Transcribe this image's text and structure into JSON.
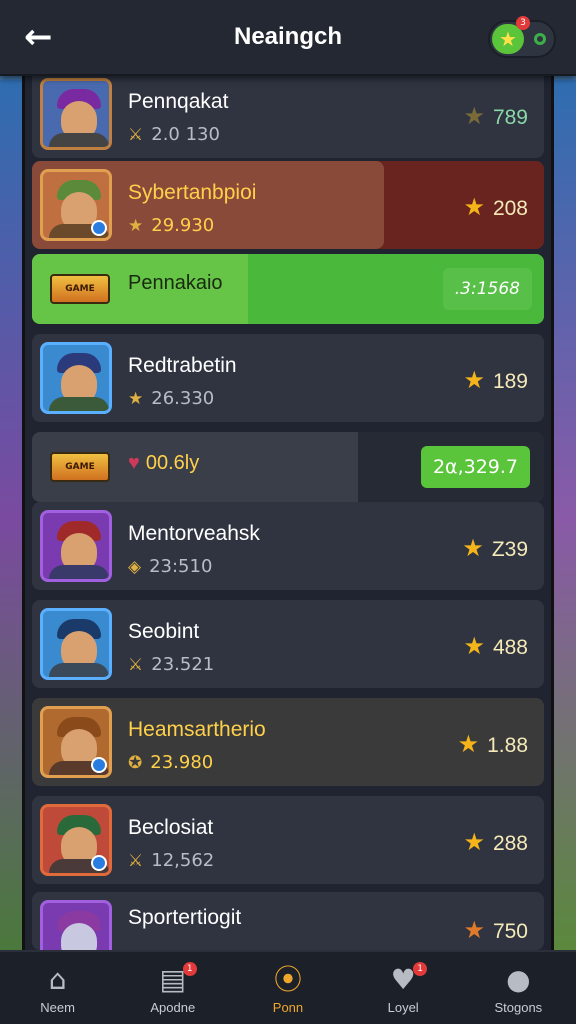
{
  "header": {
    "title": "Neaingch",
    "back_icon": "arrow-left-icon",
    "toggle_badge": "3"
  },
  "rows": [
    {
      "name": "Pennqakat",
      "sub": "2.0 130",
      "score": "789",
      "hat": "#7a2aa0",
      "border": "#c08040"
    },
    {
      "name": "Sybertanbpioi",
      "sub": "29.930",
      "score": "208",
      "hat": "#5a8a3a",
      "border": "#e0a050"
    },
    {
      "name": "Redtrabetin",
      "sub": "26.330",
      "score": "189",
      "hat": "#2a3a7a",
      "border": "#5ab0ff"
    },
    {
      "name": "Mentorveahsk",
      "sub": "23:510",
      "score": "Z39",
      "hat": "#a02a2a",
      "border": "#a060e0"
    },
    {
      "name": "Seobint",
      "sub": "23.521",
      "score": "488",
      "hat": "#1a3a6a",
      "border": "#5ab0ff"
    },
    {
      "name": "Heamsartherio",
      "sub": "23.980",
      "score": "1.88",
      "hat": "#8a4a1a",
      "border": "#e0a050"
    },
    {
      "name": "Beclosiat",
      "sub": "12,562",
      "score": "288",
      "hat": "#2a6a3a",
      "border": "#e06a3a"
    },
    {
      "name": "Sportertiogit",
      "sub": "",
      "score": "750",
      "hat": "#8a3aa0",
      "border": "#a060e0"
    }
  ],
  "bars": [
    {
      "text": "Pennakaio",
      "value": ".3:1568",
      "logo": "GAME"
    },
    {
      "text": "00.6ly",
      "value": "2α,329.7",
      "logo": "GAME"
    }
  ],
  "nav": [
    {
      "label": "Neem",
      "icon": "⌂",
      "name": "home-icon"
    },
    {
      "label": "Apodne",
      "icon": "▤",
      "name": "inbox-icon",
      "badge": "1"
    },
    {
      "label": "Ponn",
      "icon": "⦿",
      "name": "search-icon",
      "active": true
    },
    {
      "label": "Loyel",
      "icon": "♥",
      "name": "shield-icon",
      "badge": "1"
    },
    {
      "label": "Stogons",
      "icon": "●",
      "name": "profile-icon"
    }
  ]
}
